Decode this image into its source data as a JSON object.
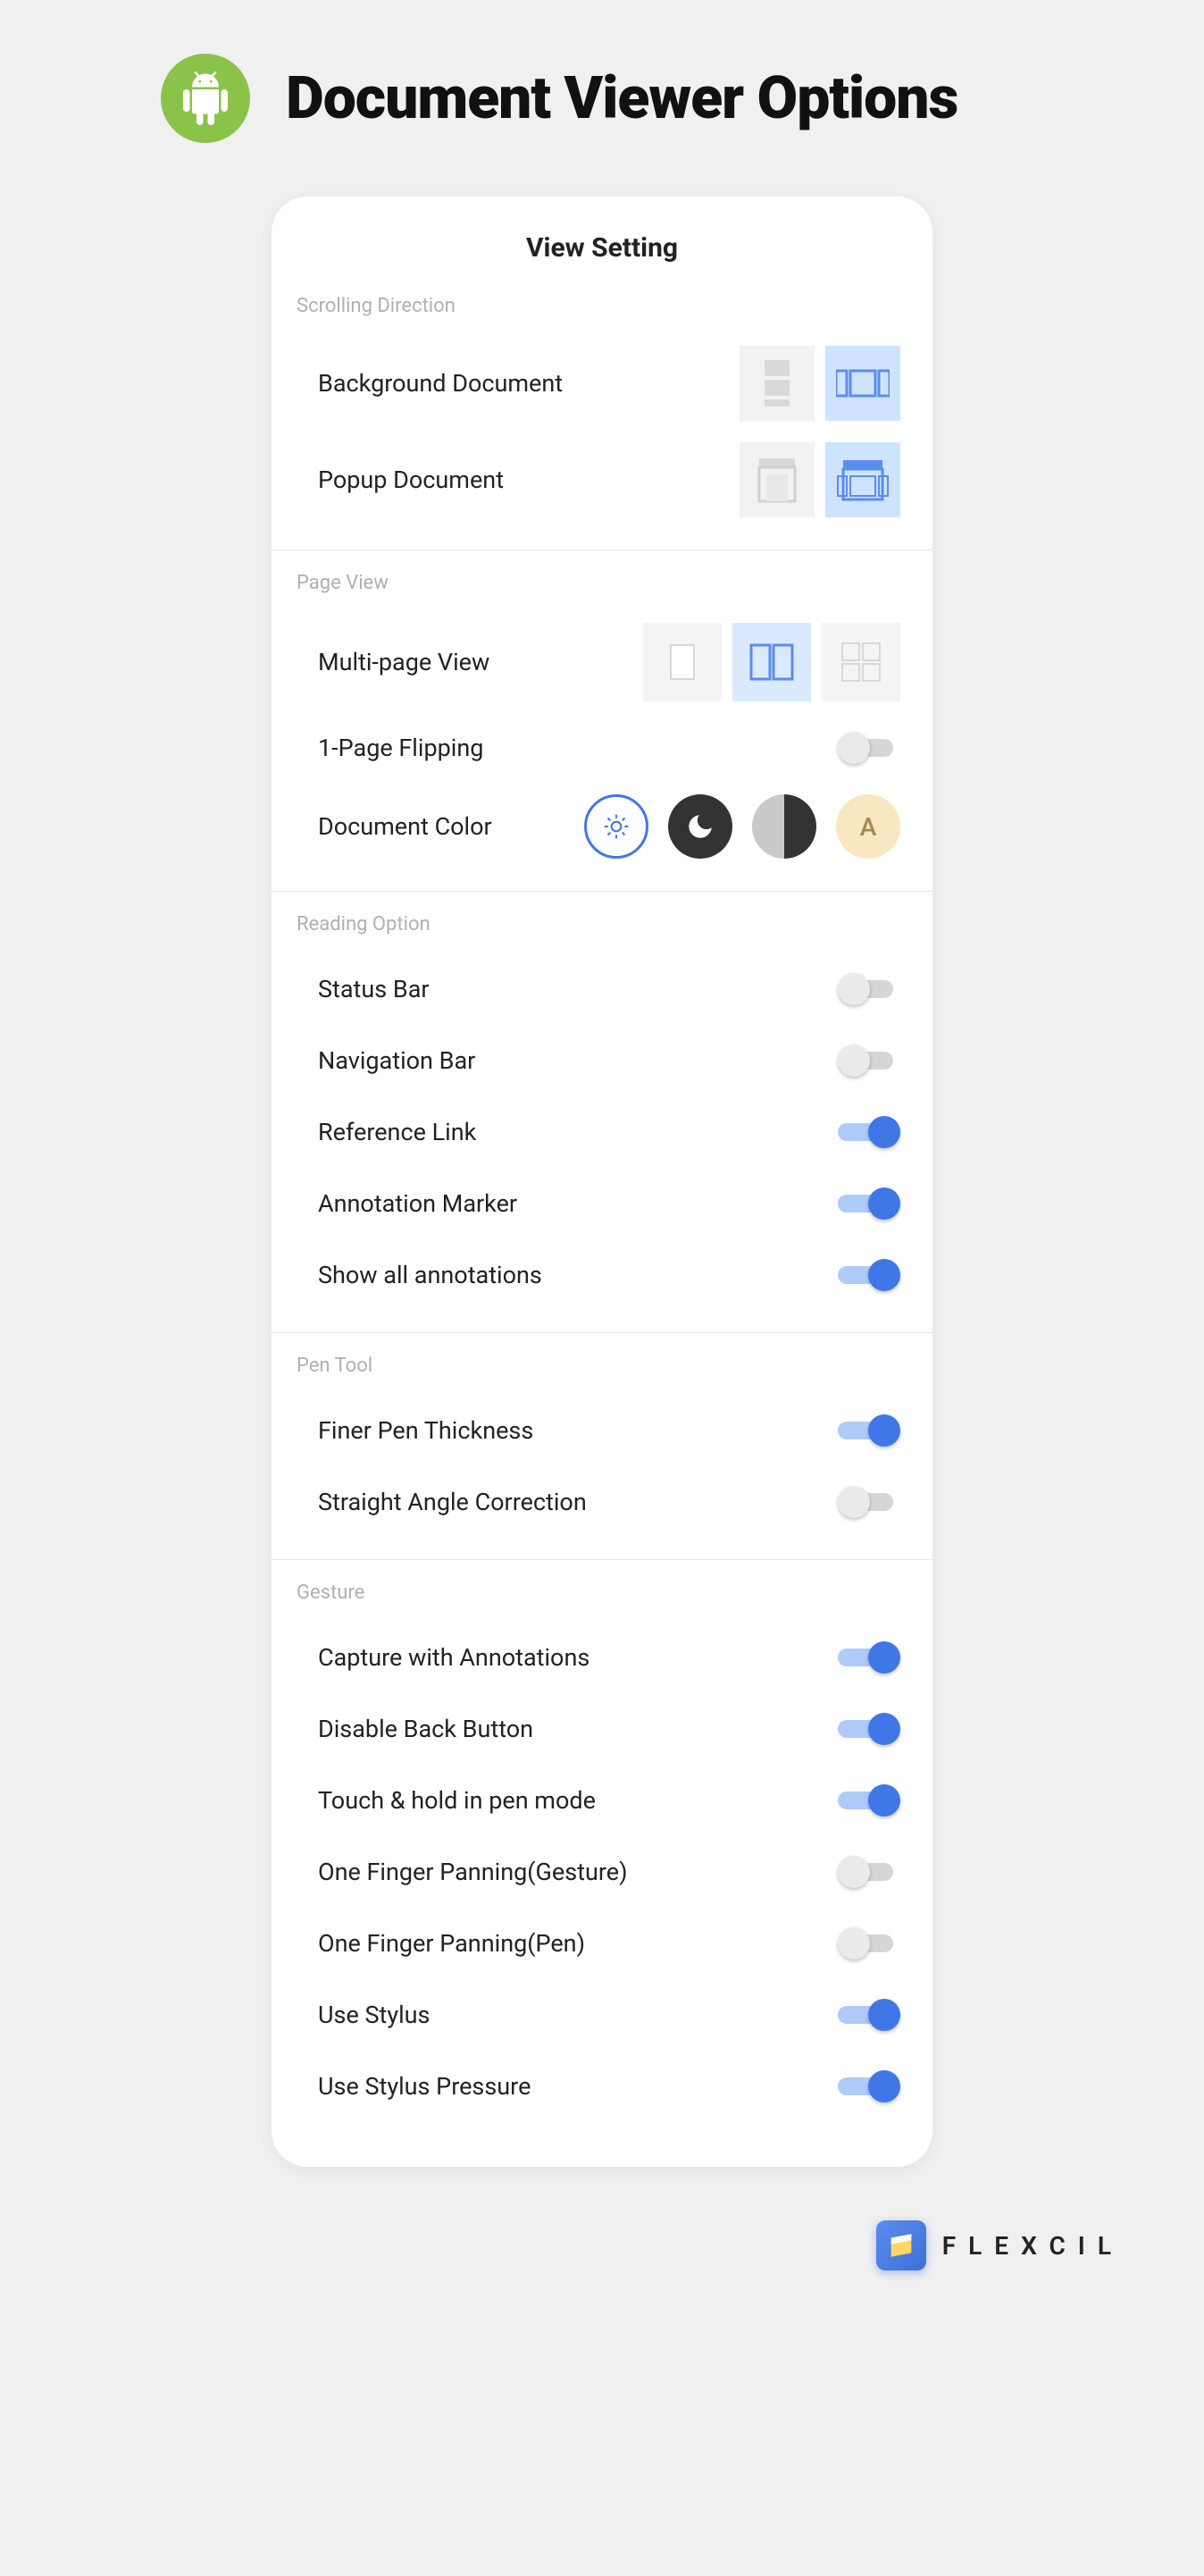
{
  "page_title": "Document Viewer Options",
  "panel_title": "View Setting",
  "sections": {
    "scrolling": {
      "label": "Scrolling Direction",
      "bg_doc": "Background Document",
      "popup_doc": "Popup Document"
    },
    "page_view": {
      "label": "Page View",
      "multi": "Multi-page View",
      "flip": "1-Page Flipping",
      "color": "Document Color",
      "sepia_letter": "A"
    },
    "reading": {
      "label": "Reading Option",
      "status_bar": "Status Bar",
      "nav_bar": "Navigation Bar",
      "ref_link": "Reference Link",
      "anno_marker": "Annotation Marker",
      "show_all": "Show all annotations"
    },
    "pen": {
      "label": "Pen Tool",
      "finer": "Finer Pen Thickness",
      "angle": "Straight Angle Correction"
    },
    "gesture": {
      "label": "Gesture",
      "capture": "Capture with Annotations",
      "disable_back": "Disable Back Button",
      "hold_pen": "Touch & hold in pen mode",
      "one_finger_g": "One Finger Panning(Gesture)",
      "one_finger_p": "One Finger Panning(Pen)",
      "stylus": "Use Stylus",
      "stylus_press": "Use Stylus Pressure"
    }
  },
  "toggles": {
    "flip": false,
    "status_bar": false,
    "nav_bar": false,
    "ref_link": true,
    "anno_marker": true,
    "show_all": true,
    "finer": true,
    "angle": false,
    "capture": true,
    "disable_back": true,
    "hold_pen": true,
    "one_finger_g": false,
    "one_finger_p": false,
    "stylus": true,
    "stylus_press": true
  },
  "footer_brand": "FLEXCIL"
}
